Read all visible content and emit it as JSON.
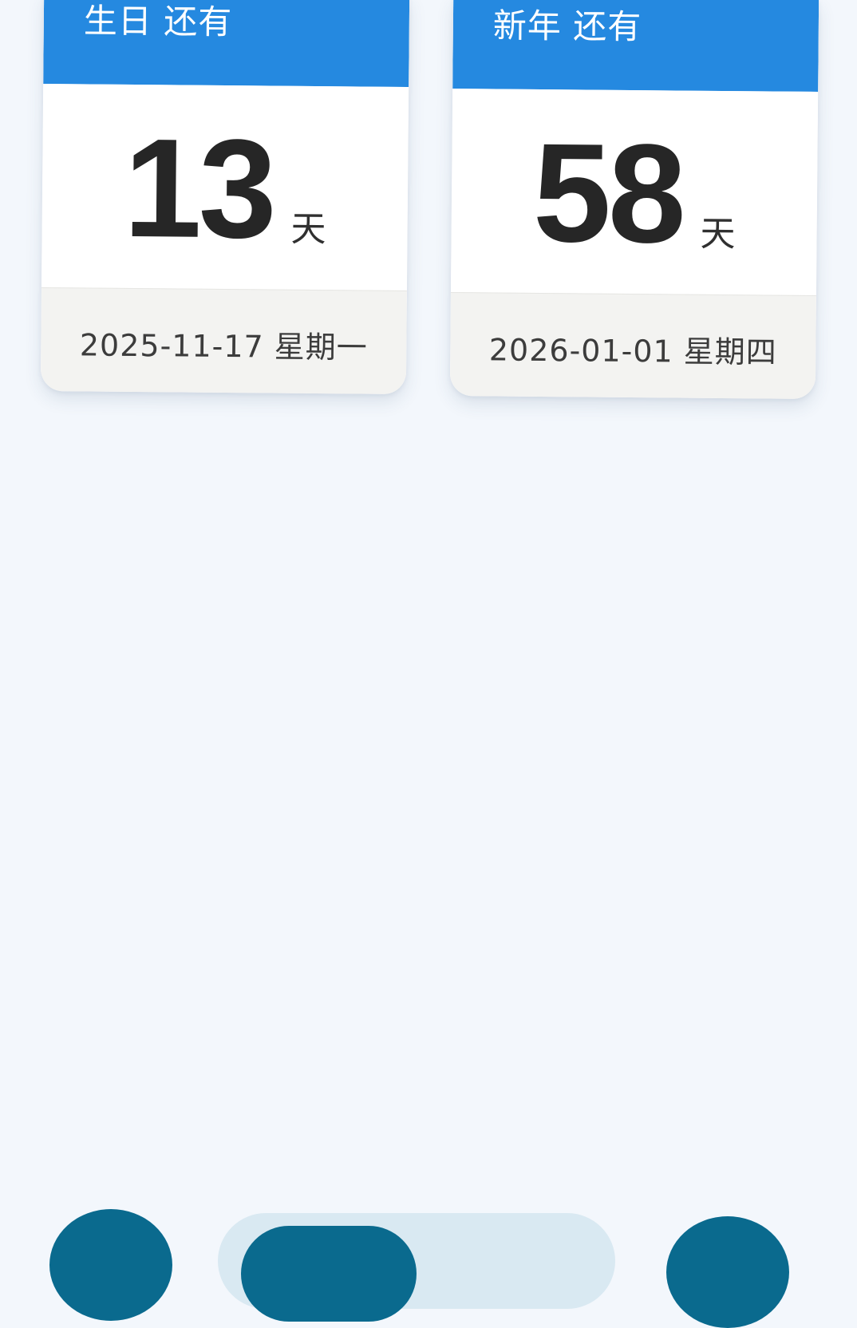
{
  "cards": [
    {
      "title": "生日 还有",
      "count": "13",
      "unit": "天",
      "date": "2025-11-17 星期一"
    },
    {
      "title": "新年 还有",
      "count": "58",
      "unit": "天",
      "date": "2026-01-01 星期四"
    }
  ],
  "colors": {
    "header": "#2589e0",
    "background": "#f3f7fc",
    "footer": "#f3f3f1",
    "nav_button": "#0a6a8e",
    "nav_pill": "#d9e9f2"
  }
}
